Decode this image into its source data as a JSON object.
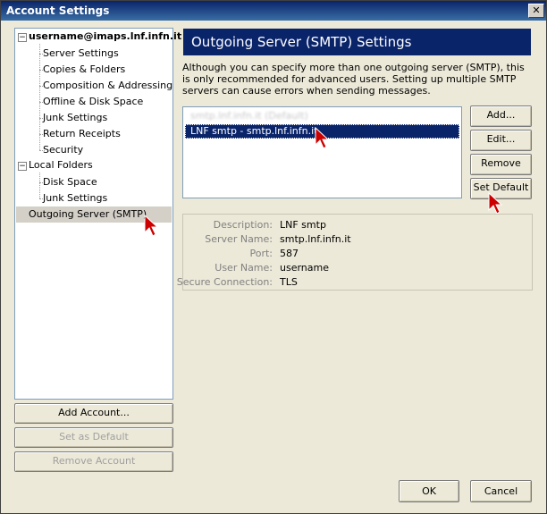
{
  "window": {
    "title": "Account Settings",
    "close_glyph": "✕"
  },
  "tree": {
    "account": "username@imaps.lnf.infn.it",
    "account_items": [
      "Server Settings",
      "Copies & Folders",
      "Composition & Addressing",
      "Offline & Disk Space",
      "Junk Settings",
      "Return Receipts",
      "Security"
    ],
    "local_folders": "Local Folders",
    "local_items": [
      "Disk Space",
      "Junk Settings"
    ],
    "outgoing": "Outgoing Server (SMTP)",
    "expander_glyph": "−"
  },
  "left_buttons": {
    "add_account": "Add Account...",
    "set_default": "Set as Default",
    "remove_account": "Remove Account"
  },
  "smtp": {
    "header": "Outgoing Server (SMTP) Settings",
    "description": "Although you can specify more than one outgoing server (SMTP), this is only recommended for advanced users. Setting up multiple SMTP servers can cause errors when sending messages.",
    "servers": [
      {
        "label": "smtp.lnf.infn.it (Default)",
        "blurred": true
      },
      {
        "label": "LNF smtp - smtp.lnf.infn.it",
        "selected": true
      }
    ],
    "buttons": {
      "add": "Add...",
      "edit": "Edit...",
      "remove": "Remove",
      "set_default": "Set Default"
    },
    "details": {
      "description_label": "Description:",
      "description_value": "LNF smtp",
      "server_label": "Server Name:",
      "server_value": "smtp.lnf.infn.it",
      "port_label": "Port:",
      "port_value": "587",
      "user_label": "User Name:",
      "user_value": "username",
      "secure_label": "Secure Connection:",
      "secure_value": "TLS"
    }
  },
  "footer": {
    "ok": "OK",
    "cancel": "Cancel"
  },
  "colors": {
    "header_bg": "#0a246a",
    "selection": "#0a246a",
    "arrow": "#cc0000"
  }
}
